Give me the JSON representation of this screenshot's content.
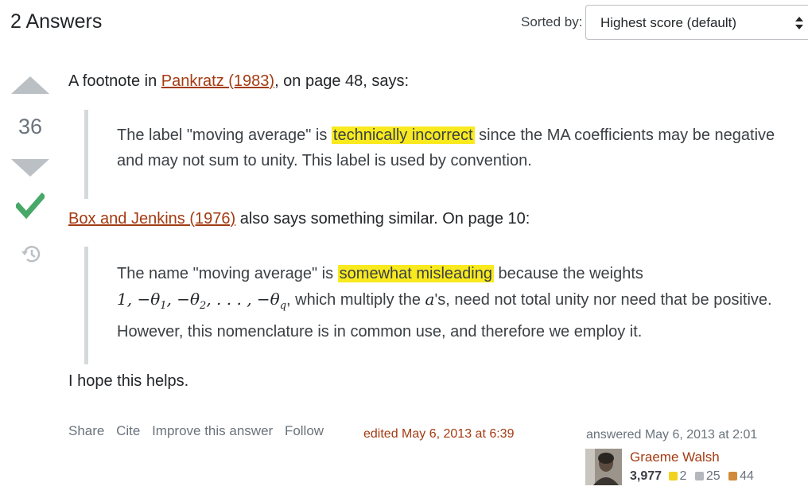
{
  "header": {
    "title": "2 Answers",
    "sort_label": "Sorted by:",
    "sort_value": "Highest score (default)"
  },
  "answer": {
    "score": "36",
    "p1": {
      "before": "A footnote in ",
      "link": "Pankratz (1983)",
      "after": ", on page 48, says:"
    },
    "quote1": {
      "before": "The label \"moving average\" is ",
      "highlight": "technically incorrect",
      "after": " since the MA coefficients may be negative and may not sum to unity. This label is used by convention."
    },
    "p2": {
      "link": "Box and Jenkins (1976)",
      "after": " also says something similar. On page 10:"
    },
    "quote2": {
      "before": "The name \"moving average\" is ",
      "highlight": "somewhat misleading",
      "after": " because the weights",
      "math": "1, −θ",
      "math_sub1": "1",
      "math_mid1": ", −θ",
      "math_sub2": "2",
      "math_mid2": ", . . . , −θ",
      "math_subq": "q",
      "after_math": ", which multiply the ",
      "a_symbol": "a",
      "tail": "'s, need not total unity nor need that be positive. However, this nomenclature is in common use, and therefore we employ it."
    },
    "p3": "I hope this helps."
  },
  "menu": {
    "share": "Share",
    "cite": "Cite",
    "improve": "Improve this answer",
    "follow": "Follow"
  },
  "edited": "edited May 6, 2013 at 6:39",
  "answered": "answered May 6, 2013 at 2:01",
  "user": {
    "name": "Graeme Walsh",
    "reputation": "3,977",
    "gold": "2",
    "silver": "25",
    "bronze": "44"
  },
  "colors": {
    "link": "#a33b12",
    "highlight": "#f8ea1f",
    "accept": "#48a868",
    "gold": "#f1d31f",
    "silver": "#b4b8bc",
    "bronze": "#d1a684"
  }
}
